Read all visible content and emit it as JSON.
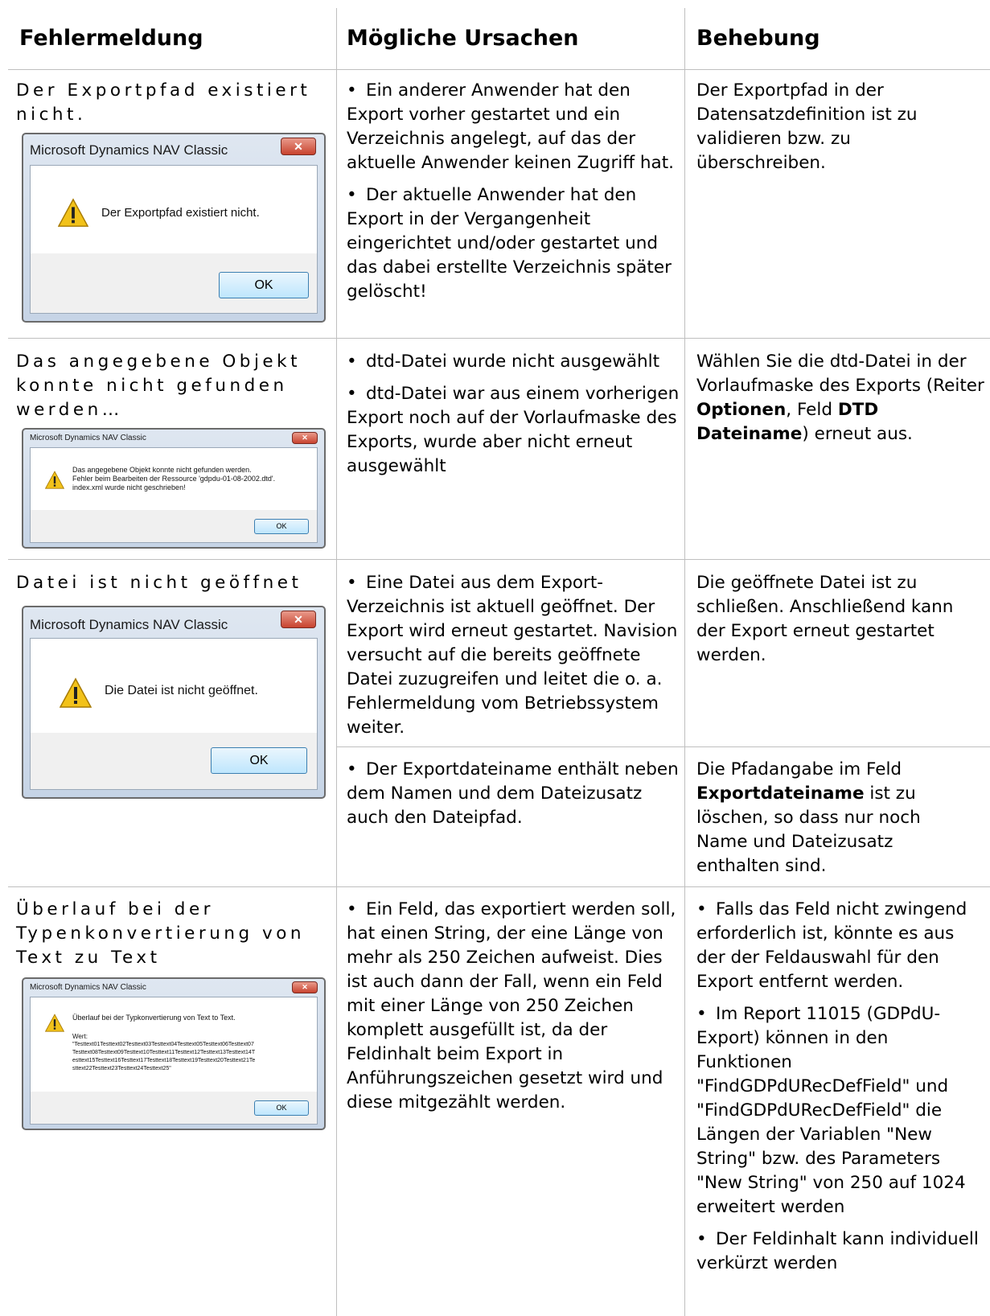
{
  "headers": [
    "Fehlermeldung",
    "Mögliche Ursachen",
    "Behebung"
  ],
  "dialog_title": "Microsoft Dynamics NAV Classic",
  "ok_label": "OK",
  "rows": [
    {
      "error": "Der Exportpfad existiert nicht.",
      "dialog_message": "Der Exportpfad existiert nicht.",
      "causes": [
        "Ein anderer Anwender hat den Export vorher gestartet und ein Verzeichnis angelegt, auf das der aktuelle Anwender keinen Zugriff hat.",
        "Der aktuelle Anwender hat den Export in der Vergangenheit eingerichtet und/oder gestartet und das dabei erstellte Verzeichnis später gelöscht!"
      ],
      "solution": "Der Exportpfad in der Datensatzdefinition ist zu validieren bzw. zu überschreiben."
    },
    {
      "error": "Das angegebene Objekt konnte nicht gefunden werden…",
      "dialog_message": "Das angegebene Objekt konnte nicht gefunden werden.\nFehler beim Bearbeiten der Ressource 'gdpdu-01-08-2002.dtd'.\nindex.xml wurde nicht geschrieben!",
      "causes": [
        "dtd-Datei wurde nicht ausgewählt",
        "dtd-Datei war aus einem vorherigen Export noch auf der Vorlaufmaske des Exports, wurde aber nicht erneut ausgewählt"
      ],
      "solution_pre": "Wählen Sie die dtd-Datei in der Vorlaufmaske des Exports (Reiter ",
      "solution_b1": "Optionen",
      "solution_mid": ", Feld ",
      "solution_b2": "DTD Dateiname",
      "solution_post": ") erneut aus."
    },
    {
      "error": "Datei ist nicht geöffnet",
      "dialog_message": "Die Datei ist nicht geöffnet.",
      "causes": [
        "Eine Datei aus dem Export-Verzeichnis ist aktuell geöffnet. Der Export wird erneut gestartet. Navision versucht auf die bereits geöffnete Datei zuzugreifen und leitet die o. a. Fehlermeldung vom Betriebssystem weiter."
      ],
      "solution": "Die geöffnete Datei ist zu schließen. Anschließend kann der Export erneut gestartet werden."
    },
    {
      "causes": [
        "Der Exportdateiname enthält neben dem Namen und dem Dateizusatz auch den Dateipfad."
      ],
      "solution_pre": "Die Pfadangabe im Feld ",
      "solution_b1": "Exportdateiname",
      "solution_post": " ist zu löschen, so dass nur noch Name und Dateizusatz enthalten sind."
    },
    {
      "error": "Überlauf bei der Typenkonvertierung von Text zu Text",
      "dialog_message": "Überlauf bei der Typkonvertierung von Text to Text.",
      "dialog_value_label": "Wert:",
      "dialog_value": "\"Testtext01Testtext02Testtext03Testtext04Testtext05Testtext06Testtext07\nTesttext08Testtext09Testtext10Testtext11Testtext12Testtext13Testtext14T\nesttext15Testtext16Testtext17Testtext18Testtext19Testtext20Testtext21Te\nsttext22Testtext23Testtext24Testtext25\"",
      "causes": [
        "Ein Feld, das exportiert werden soll, hat einen String, der eine Länge von mehr als 250 Zeichen aufweist. Dies ist auch dann der Fall, wenn ein Feld mit einer Länge von 250 Zeichen komplett ausgefüllt ist, da der Feldinhalt beim Export in Anführungszeichen gesetzt wird und diese mitgezählt werden."
      ],
      "solutions": [
        "Falls das Feld nicht zwingend erforderlich ist, könnte es aus der der Feldauswahl für den Export entfernt werden.",
        "Im Report 11015 (GDPdU-Export) können in den Funktionen \"FindGDPdURecDefField\" und \"FindGDPdURecDefField\" die Längen der Variablen \"New String\" bzw. des Parameters \"New String\" von 250 auf 1024 erweitert werden",
        "Der Feldinhalt kann individuell verkürzt werden"
      ]
    }
  ]
}
